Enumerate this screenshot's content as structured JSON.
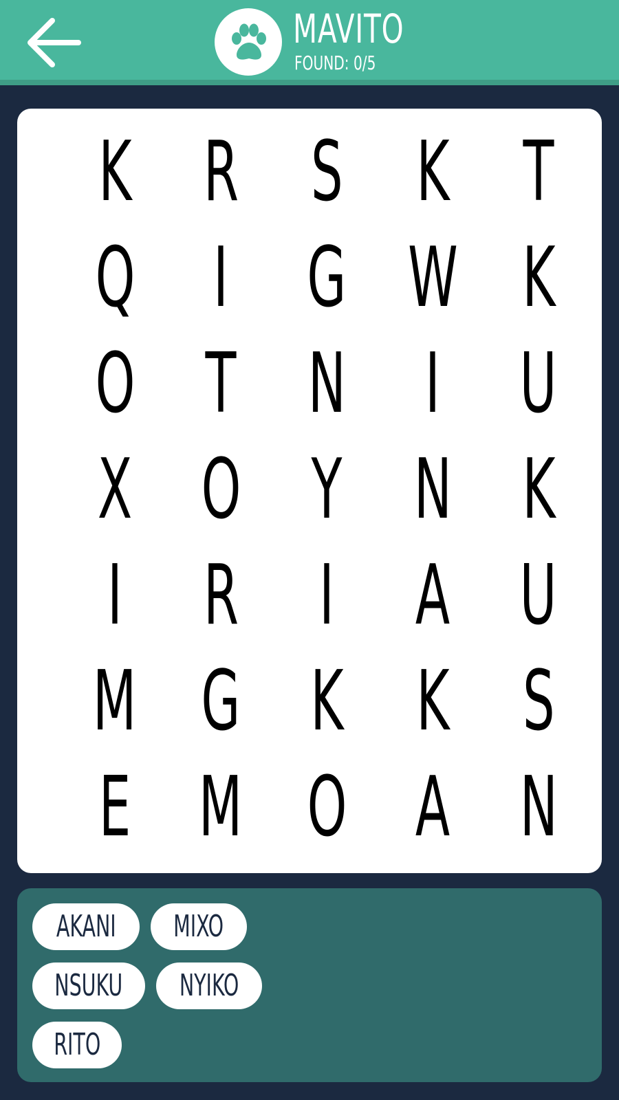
{
  "header": {
    "title": "MAVITO",
    "found_label": "FOUND: 0/5",
    "back_icon": "arrow-left-icon",
    "category_icon": "paw-icon"
  },
  "grid": {
    "rows": [
      [
        "K",
        "R",
        "S",
        "K",
        "T"
      ],
      [
        "Q",
        "I",
        "G",
        "W",
        "K"
      ],
      [
        "O",
        "T",
        "N",
        "I",
        "U"
      ],
      [
        "X",
        "O",
        "Y",
        "N",
        "K"
      ],
      [
        "I",
        "R",
        "I",
        "A",
        "U"
      ],
      [
        "M",
        "G",
        "K",
        "K",
        "S"
      ],
      [
        "E",
        "M",
        "O",
        "A",
        "N"
      ]
    ]
  },
  "words": [
    "AKANI",
    "MIXO",
    "NSUKU",
    "NYIKO",
    "RITO"
  ],
  "colors": {
    "header_bg": "#49b79d",
    "page_bg": "#1b2940",
    "panel_bg": "#306b6b",
    "chip_text": "#1b2940"
  }
}
